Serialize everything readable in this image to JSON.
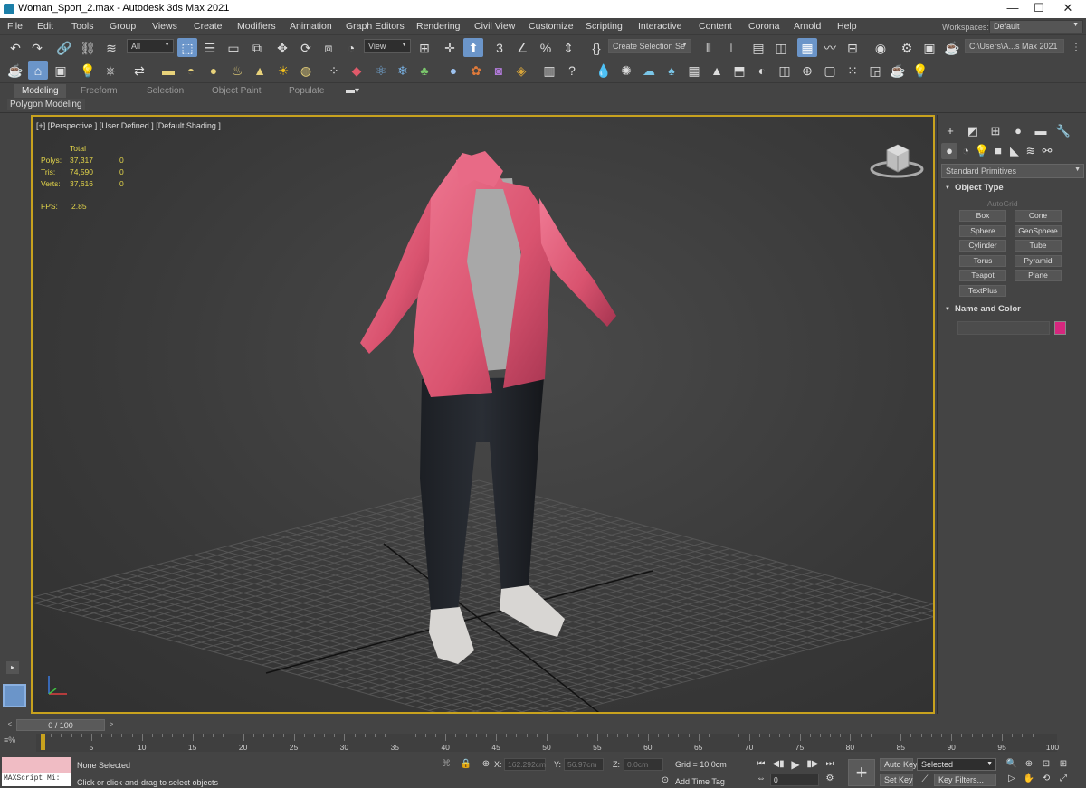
{
  "window": {
    "title": "Woman_Sport_2.max - Autodesk 3ds Max 2021",
    "minimize": "—",
    "maximize": "☐",
    "close": "✕"
  },
  "menu": [
    "File",
    "Edit",
    "Tools",
    "Group",
    "Views",
    "Create",
    "Modifiers",
    "Animation",
    "Graph Editors",
    "Rendering",
    "Civil View",
    "Customize",
    "Scripting",
    "Interactive",
    "Content",
    "Corona",
    "Arnold",
    "Help"
  ],
  "workspaces": {
    "label": "Workspaces:",
    "value": "Default"
  },
  "toolbar": {
    "selection_filter": "All",
    "ref_coord": "View",
    "named_selection": "Create Selection Se",
    "project_path": "C:\\Users\\A...s Max 2021"
  },
  "ribbon": {
    "tabs": [
      "Modeling",
      "Freeform",
      "Selection",
      "Object Paint",
      "Populate"
    ],
    "sub_tab": "Polygon Modeling"
  },
  "viewport": {
    "label": "[+] [Perspective ] [User Defined ] [Default Shading ]",
    "stats": {
      "header": "Total",
      "rows": [
        {
          "label": "Polys:",
          "total": "37,317",
          "sel": "0"
        },
        {
          "label": "Tris:",
          "total": "74,590",
          "sel": "0"
        },
        {
          "label": "Verts:",
          "total": "37,616",
          "sel": "0"
        }
      ],
      "fps_label": "FPS:",
      "fps": "2.85"
    }
  },
  "command_panel": {
    "category": "Standard Primitives",
    "object_type": {
      "title": "Object Type",
      "autogrid": "AutoGrid",
      "buttons": [
        "Box",
        "Cone",
        "Sphere",
        "GeoSphere",
        "Cylinder",
        "Tube",
        "Torus",
        "Pyramid",
        "Teapot",
        "Plane",
        "TextPlus"
      ]
    },
    "name_color": {
      "title": "Name and Color",
      "name": "",
      "color": "#d6277e"
    }
  },
  "timeline": {
    "slider": "0 / 100",
    "ticks": [
      "0",
      "5",
      "10",
      "15",
      "20",
      "25",
      "30",
      "35",
      "40",
      "45",
      "50",
      "55",
      "60",
      "65",
      "70",
      "75",
      "80",
      "85",
      "90",
      "95",
      "100"
    ]
  },
  "status": {
    "maxscript": "MAXScript Mi:",
    "selected": "None Selected",
    "prompt": "Click or click-and-drag to select objects",
    "x_label": "X:",
    "x": "162.292cm",
    "y_label": "Y:",
    "y": "56.97cm",
    "z_label": "Z:",
    "z": "0.0cm",
    "grid": "Grid = 10.0cm",
    "add_time_tag": "Add Time Tag",
    "auto_key": "Auto Key",
    "set_key": "Set Key",
    "key_mode": "Selected",
    "key_filters": "Key Filters...",
    "frame": "0"
  },
  "colors": {
    "accent": "#6b95c9",
    "viewport_border": "#c8a21e",
    "stats": "#e2d44a"
  }
}
